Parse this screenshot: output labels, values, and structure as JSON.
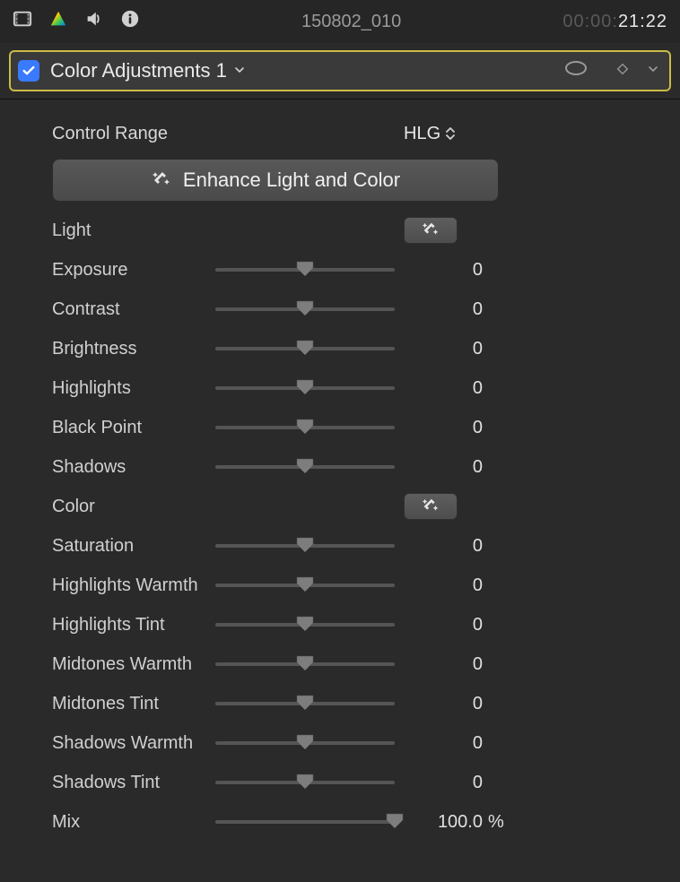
{
  "header": {
    "clip_title": "150802_010",
    "timecode_inactive": "00:00:",
    "timecode_active": "21:22"
  },
  "effect": {
    "enabled": true,
    "name": "Color Adjustments 1"
  },
  "control_range": {
    "label": "Control Range",
    "value": "HLG"
  },
  "enhance_button": "Enhance Light and Color",
  "sections": {
    "light": "Light",
    "color": "Color"
  },
  "sliders": [
    {
      "label": "Exposure",
      "value": "0",
      "pos": 50
    },
    {
      "label": "Contrast",
      "value": "0",
      "pos": 50
    },
    {
      "label": "Brightness",
      "value": "0",
      "pos": 50
    },
    {
      "label": "Highlights",
      "value": "0",
      "pos": 50
    },
    {
      "label": "Black Point",
      "value": "0",
      "pos": 50
    },
    {
      "label": "Shadows",
      "value": "0",
      "pos": 50
    }
  ],
  "color_sliders": [
    {
      "label": "Saturation",
      "value": "0",
      "pos": 50
    },
    {
      "label": "Highlights Warmth",
      "value": "0",
      "pos": 50
    },
    {
      "label": "Highlights Tint",
      "value": "0",
      "pos": 50
    },
    {
      "label": "Midtones Warmth",
      "value": "0",
      "pos": 50
    },
    {
      "label": "Midtones Tint",
      "value": "0",
      "pos": 50
    },
    {
      "label": "Shadows Warmth",
      "value": "0",
      "pos": 50
    },
    {
      "label": "Shadows Tint",
      "value": "0",
      "pos": 50
    }
  ],
  "mix": {
    "label": "Mix",
    "value": "100.0",
    "unit": "%",
    "pos": 100
  }
}
